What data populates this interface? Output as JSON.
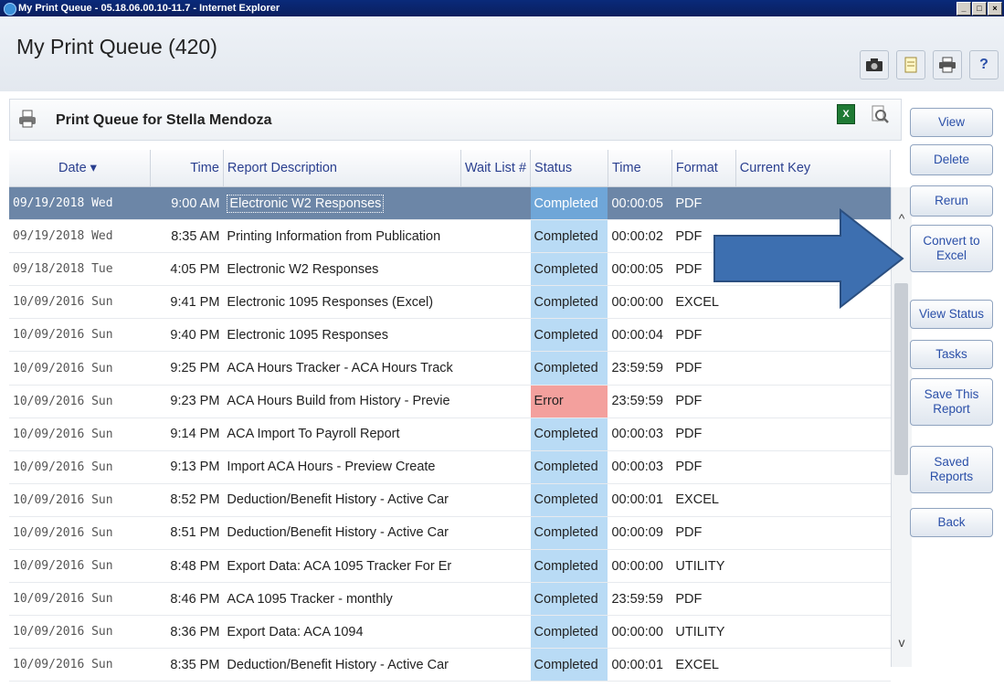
{
  "window": {
    "title": "My Print Queue - 05.18.06.00.10-11.7 - Internet Explorer",
    "buttons": [
      "_",
      "□",
      "×"
    ]
  },
  "header": {
    "title": "My Print Queue (420)",
    "tools": [
      "camera-icon",
      "notes-icon",
      "printer-icon",
      "help-icon"
    ],
    "help_glyph": "?"
  },
  "subheader": {
    "title": "Print Queue for Stella Mendoza",
    "excel_glyph": "X"
  },
  "table": {
    "columns": [
      "Date ▾",
      "Time",
      "Report Description",
      "Wait List #",
      "Status",
      "Time",
      "Format",
      "Current Key"
    ],
    "rows": [
      {
        "date": "09/19/2018 Wed",
        "time": "9:00 AM",
        "desc": "Electronic W2 Responses",
        "wait": "",
        "status": "Completed",
        "elapsed": "00:00:05",
        "format": "PDF",
        "key": ""
      },
      {
        "date": "09/19/2018 Wed",
        "time": "8:35 AM",
        "desc": "Printing Information from Publication",
        "wait": "",
        "status": "Completed",
        "elapsed": "00:00:02",
        "format": "PDF",
        "key": ""
      },
      {
        "date": "09/18/2018 Tue",
        "time": "4:05 PM",
        "desc": "Electronic W2 Responses",
        "wait": "",
        "status": "Completed",
        "elapsed": "00:00:05",
        "format": "PDF",
        "key": ""
      },
      {
        "date": "10/09/2016 Sun",
        "time": "9:41 PM",
        "desc": "Electronic 1095 Responses (Excel)",
        "wait": "",
        "status": "Completed",
        "elapsed": "00:00:00",
        "format": "EXCEL",
        "key": ""
      },
      {
        "date": "10/09/2016 Sun",
        "time": "9:40 PM",
        "desc": "Electronic 1095 Responses",
        "wait": "",
        "status": "Completed",
        "elapsed": "00:00:04",
        "format": "PDF",
        "key": ""
      },
      {
        "date": "10/09/2016 Sun",
        "time": "9:25 PM",
        "desc": "ACA Hours Tracker - ACA Hours Track",
        "wait": "",
        "status": "Completed",
        "elapsed": "23:59:59",
        "format": "PDF",
        "key": ""
      },
      {
        "date": "10/09/2016 Sun",
        "time": "9:23 PM",
        "desc": "ACA Hours Build from History - Previe",
        "wait": "",
        "status": "Error",
        "elapsed": "23:59:59",
        "format": "PDF",
        "key": ""
      },
      {
        "date": "10/09/2016 Sun",
        "time": "9:14 PM",
        "desc": "ACA Import To Payroll Report",
        "wait": "",
        "status": "Completed",
        "elapsed": "00:00:03",
        "format": "PDF",
        "key": ""
      },
      {
        "date": "10/09/2016 Sun",
        "time": "9:13 PM",
        "desc": "Import ACA Hours - Preview Create",
        "wait": "",
        "status": "Completed",
        "elapsed": "00:00:03",
        "format": "PDF",
        "key": ""
      },
      {
        "date": "10/09/2016 Sun",
        "time": "8:52 PM",
        "desc": "Deduction/Benefit History - Active Car",
        "wait": "",
        "status": "Completed",
        "elapsed": "00:00:01",
        "format": "EXCEL",
        "key": ""
      },
      {
        "date": "10/09/2016 Sun",
        "time": "8:51 PM",
        "desc": "Deduction/Benefit History - Active Car",
        "wait": "",
        "status": "Completed",
        "elapsed": "00:00:09",
        "format": "PDF",
        "key": ""
      },
      {
        "date": "10/09/2016 Sun",
        "time": "8:48 PM",
        "desc": "Export Data: ACA 1095 Tracker For Er",
        "wait": "",
        "status": "Completed",
        "elapsed": "00:00:00",
        "format": "UTILITY",
        "key": ""
      },
      {
        "date": "10/09/2016 Sun",
        "time": "8:46 PM",
        "desc": "ACA 1095 Tracker - monthly",
        "wait": "",
        "status": "Completed",
        "elapsed": "23:59:59",
        "format": "PDF",
        "key": ""
      },
      {
        "date": "10/09/2016 Sun",
        "time": "8:36 PM",
        "desc": "Export Data: ACA 1094",
        "wait": "",
        "status": "Completed",
        "elapsed": "00:00:00",
        "format": "UTILITY",
        "key": ""
      },
      {
        "date": "10/09/2016 Sun",
        "time": "8:35 PM",
        "desc": "Deduction/Benefit History - Active Car",
        "wait": "",
        "status": "Completed",
        "elapsed": "00:00:01",
        "format": "EXCEL",
        "key": ""
      }
    ]
  },
  "scrollbar": {
    "up": "^",
    "down": "v"
  },
  "sidebar": {
    "buttons": [
      {
        "label": "View",
        "name": "view-button"
      },
      {
        "label": "Delete",
        "name": "delete-button"
      },
      {
        "label": "Rerun",
        "name": "rerun-button"
      },
      {
        "label": "Convert to\nExcel",
        "name": "convert-to-excel-button"
      },
      {
        "label": "View Status",
        "name": "view-status-button"
      },
      {
        "label": "Tasks",
        "name": "tasks-button"
      },
      {
        "label": "Save This\nReport",
        "name": "save-this-report-button"
      },
      {
        "label": "Saved\nReports",
        "name": "saved-reports-button"
      },
      {
        "label": "Back",
        "name": "back-button"
      }
    ]
  },
  "colors": {
    "titlebar": "#0b1f5e",
    "selected_row": "#6c86a7",
    "completed": "#b9dbf5",
    "error": "#f3a09d",
    "arrow": "#3d6fb0",
    "link": "#2a4fa8"
  }
}
